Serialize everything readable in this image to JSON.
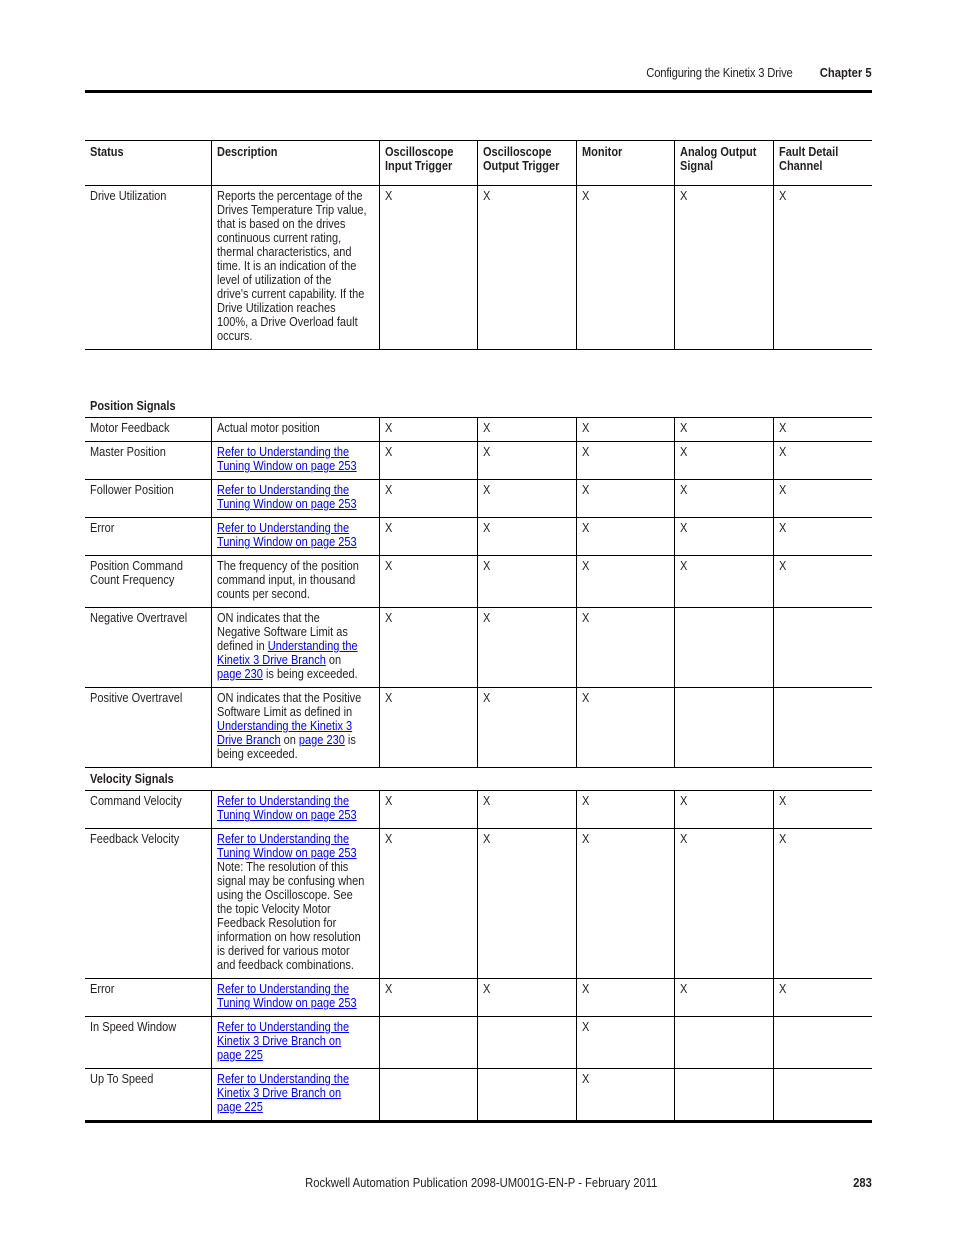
{
  "header": {
    "title": "Configuring the Kinetix 3 Drive",
    "chapter": "Chapter 5"
  },
  "table": {
    "columns": [
      "Status",
      "Description",
      "Oscilloscope Input Trigger",
      "Oscilloscope Output Trigger",
      "Monitor",
      "Analog Output Signal",
      "Fault Detail Channel"
    ],
    "columns_lines": [
      [
        "Status"
      ],
      [
        "Description"
      ],
      [
        "Oscilloscope",
        "Input Trigger"
      ],
      [
        "Oscilloscope",
        "Output Trigger"
      ],
      [
        "Monitor"
      ],
      [
        "Analog Output",
        "Signal"
      ],
      [
        "Fault Detail",
        "Channel"
      ]
    ],
    "top_rows": [
      {
        "status": "Drive Utilization",
        "description_lines": [
          [
            {
              "text": "Reports the percentage of the"
            }
          ],
          [
            {
              "text": "Drives Temperature Trip value,"
            }
          ],
          [
            {
              "text": "that is based on the drives"
            }
          ],
          [
            {
              "text": "continuous current rating,"
            }
          ],
          [
            {
              "text": "thermal characteristics, and"
            }
          ],
          [
            {
              "text": "time. It is an indication of the"
            }
          ],
          [
            {
              "text": "level of utilization of the"
            }
          ],
          [
            {
              "text": "drive's current capability. If the"
            }
          ],
          [
            {
              "text": "Drive Utilization reaches"
            }
          ],
          [
            {
              "text": "100%, a Drive Overload fault"
            }
          ],
          [
            {
              "text": "occurs."
            }
          ]
        ],
        "marks": [
          "X",
          "X",
          "X",
          "X",
          "X"
        ]
      }
    ],
    "sections": [
      {
        "title": "Position Signals",
        "rows": [
          {
            "status": [
              "Motor Feedback"
            ],
            "description_lines": [
              [
                {
                  "text": "Actual motor position"
                }
              ]
            ],
            "marks": [
              "X",
              "X",
              "X",
              "X",
              "X"
            ]
          },
          {
            "status": [
              "Master Position"
            ],
            "description_lines": [
              [
                {
                  "text": "Refer to Understanding the ",
                  "link": true
                }
              ],
              [
                {
                  "text": "Tuning Window on page 253",
                  "link": true
                }
              ]
            ],
            "marks": [
              "X",
              "X",
              "X",
              "X",
              "X"
            ]
          },
          {
            "status": [
              "Follower Position"
            ],
            "description_lines": [
              [
                {
                  "text": "Refer to Understanding the ",
                  "link": true
                }
              ],
              [
                {
                  "text": "Tuning Window on page 253",
                  "link": true
                }
              ]
            ],
            "marks": [
              "X",
              "X",
              "X",
              "X",
              "X"
            ]
          },
          {
            "status": [
              "Error"
            ],
            "description_lines": [
              [
                {
                  "text": "Refer to Understanding the ",
                  "link": true
                }
              ],
              [
                {
                  "text": "Tuning Window on page 253",
                  "link": true
                }
              ]
            ],
            "marks": [
              "X",
              "X",
              "X",
              "X",
              "X"
            ]
          },
          {
            "status": [
              "Position Command",
              "Count Frequency"
            ],
            "description_lines": [
              [
                {
                  "text": "The frequency of the position"
                }
              ],
              [
                {
                  "text": "command input, in thousand"
                }
              ],
              [
                {
                  "text": "counts per second."
                }
              ]
            ],
            "marks": [
              "X",
              "X",
              "X",
              "X",
              "X"
            ]
          },
          {
            "status": [
              "Negative Overtravel"
            ],
            "description_lines": [
              [
                {
                  "text": "ON indicates that the"
                }
              ],
              [
                {
                  "text": "Negative Software Limit as"
                }
              ],
              [
                {
                  "text": "defined in "
                },
                {
                  "text": "Understanding the ",
                  "link": true
                }
              ],
              [
                {
                  "text": "Kinetix 3 Drive Branch",
                  "link": true
                },
                {
                  "text": " on"
                }
              ],
              [
                {
                  "text": "page 230",
                  "link": true
                },
                {
                  "text": " is being exceeded."
                }
              ]
            ],
            "marks": [
              "X",
              "X",
              "X",
              "",
              ""
            ]
          },
          {
            "status": [
              "Positive Overtravel"
            ],
            "description_lines": [
              [
                {
                  "text": "ON indicates that the Positive"
                }
              ],
              [
                {
                  "text": "Software Limit as defined in"
                }
              ],
              [
                {
                  "text": "Understanding the Kinetix 3 ",
                  "link": true
                }
              ],
              [
                {
                  "text": "Drive Branch",
                  "link": true
                },
                {
                  "text": " on "
                },
                {
                  "text": "page 230",
                  "link": true
                },
                {
                  "text": " is"
                }
              ],
              [
                {
                  "text": "being exceeded."
                }
              ]
            ],
            "marks": [
              "X",
              "X",
              "X",
              "",
              ""
            ]
          }
        ]
      },
      {
        "title": "Velocity Signals",
        "rows": [
          {
            "status": [
              "Command Velocity"
            ],
            "description_lines": [
              [
                {
                  "text": "Refer to Understanding the ",
                  "link": true
                }
              ],
              [
                {
                  "text": "Tuning Window on page 253",
                  "link": true
                }
              ]
            ],
            "marks": [
              "X",
              "X",
              "X",
              "X",
              "X"
            ]
          },
          {
            "status": [
              "Feedback Velocity"
            ],
            "description_lines": [
              [
                {
                  "text": "Refer to Understanding the ",
                  "link": true
                }
              ],
              [
                {
                  "text": "Tuning Window on page 253",
                  "link": true
                }
              ],
              [
                {
                  "text": "Note: The resolution of this"
                }
              ],
              [
                {
                  "text": "signal may be confusing when"
                }
              ],
              [
                {
                  "text": "using the Oscilloscope. See"
                }
              ],
              [
                {
                  "text": "the topic Velocity Motor"
                }
              ],
              [
                {
                  "text": "Feedback Resolution for"
                }
              ],
              [
                {
                  "text": "information on how resolution"
                }
              ],
              [
                {
                  "text": "is derived for various motor"
                }
              ],
              [
                {
                  "text": "and feedback combinations."
                }
              ]
            ],
            "marks": [
              "X",
              "X",
              "X",
              "X",
              "X"
            ]
          },
          {
            "status": [
              "Error"
            ],
            "description_lines": [
              [
                {
                  "text": "Refer to Understanding the ",
                  "link": true
                }
              ],
              [
                {
                  "text": "Tuning Window on page 253",
                  "link": true
                }
              ]
            ],
            "marks": [
              "X",
              "X",
              "X",
              "X",
              "X"
            ]
          },
          {
            "status": [
              "In Speed Window"
            ],
            "description_lines": [
              [
                {
                  "text": "Refer to Understanding the ",
                  "link": true
                }
              ],
              [
                {
                  "text": "Kinetix 3 Drive Branch on ",
                  "link": true
                }
              ],
              [
                {
                  "text": "page 225",
                  "link": true
                }
              ]
            ],
            "marks": [
              "",
              "",
              "X",
              "",
              ""
            ]
          },
          {
            "status": [
              "Up To Speed"
            ],
            "description_lines": [
              [
                {
                  "text": "Refer to Understanding the ",
                  "link": true
                }
              ],
              [
                {
                  "text": "Kinetix 3 Drive Branch on ",
                  "link": true
                }
              ],
              [
                {
                  "text": "page 225",
                  "link": true
                }
              ]
            ],
            "marks": [
              "",
              "",
              "X",
              "",
              ""
            ]
          }
        ]
      }
    ]
  },
  "footer": {
    "publication": "Rockwell Automation Publication 2098-UM001G-EN-P  - February 2011",
    "page_number": "283"
  },
  "colors": {
    "link": "#0000ee",
    "text": "#231f20",
    "rule": "#000000"
  }
}
